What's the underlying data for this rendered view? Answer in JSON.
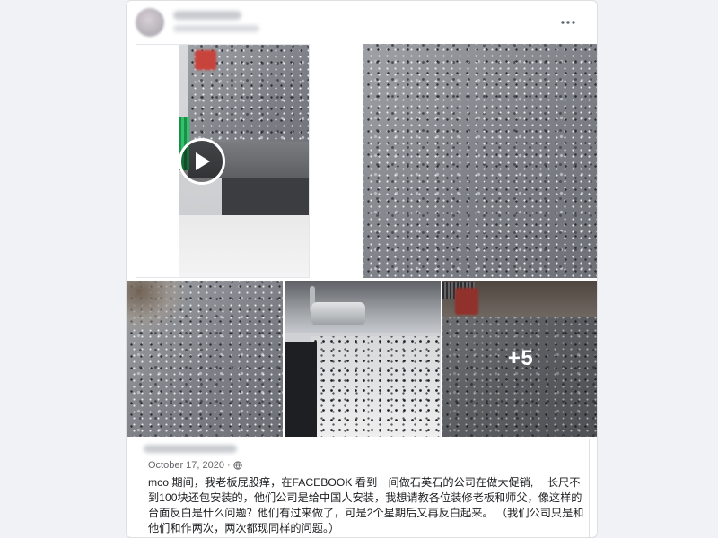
{
  "post": {
    "date": "October 17, 2020",
    "separator": "·",
    "text": "mco 期间，我老板屁股痒，在FACEBOOK 看到一间做石英石的公司在做大促销, 一长尺不到100块还包安装的，他们公司是给中国人安装，我想请教各位装修老板和师父，像这样的台面反白是什么问题？他们有过来做了，可是2个星期后又再反白起来。 （我们公司只是和他们和作两次，两次都现同样的问题。）"
  },
  "media": {
    "more_count": "+5"
  },
  "icons": {
    "more": "more-dots-icon",
    "play": "play-icon",
    "privacy": "globe-icon"
  },
  "colors": {
    "page_bg": "#f0f2f5",
    "card_bg": "#ffffff",
    "meta_text": "#65676b",
    "body_text": "#1c1e21"
  }
}
